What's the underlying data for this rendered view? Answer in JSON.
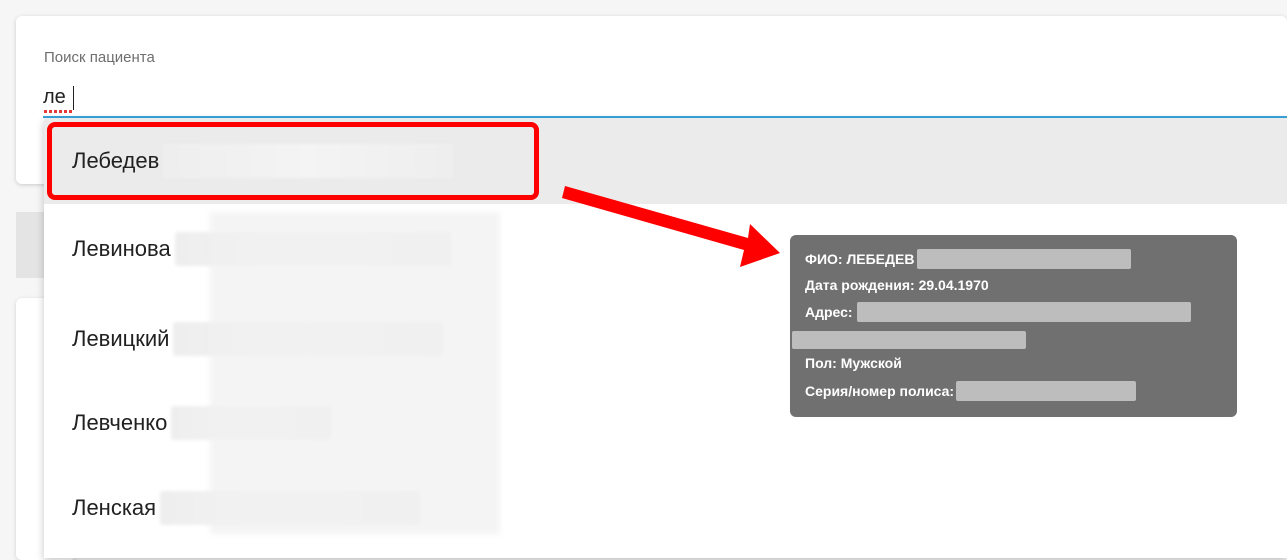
{
  "search": {
    "label": "Поиск пациента",
    "value": "ле"
  },
  "dropdown": {
    "options": [
      {
        "surname": "Лебедев",
        "rest": "(скрыто)"
      },
      {
        "surname": "Левинова",
        "rest": "(скрыто)"
      },
      {
        "surname": "Левицкий",
        "rest": "(скрыто)"
      },
      {
        "surname": "Левченко",
        "rest": "(скрыто)"
      },
      {
        "surname": "Ленская",
        "rest": "(скрыто)"
      }
    ]
  },
  "tooltip": {
    "fio_label": "ФИО: ЛЕБЕДЕВ",
    "birth": "Дата рождения: 29.04.1970",
    "address_label": "Адрес:",
    "sex": "Пол: Мужской",
    "policy_label": "Серия/номер полиса:"
  },
  "colors": {
    "highlight": "#ff0000",
    "arrow": "#ff0000",
    "input_underline": "#39a3dc",
    "tooltip_bg": "#707070"
  }
}
